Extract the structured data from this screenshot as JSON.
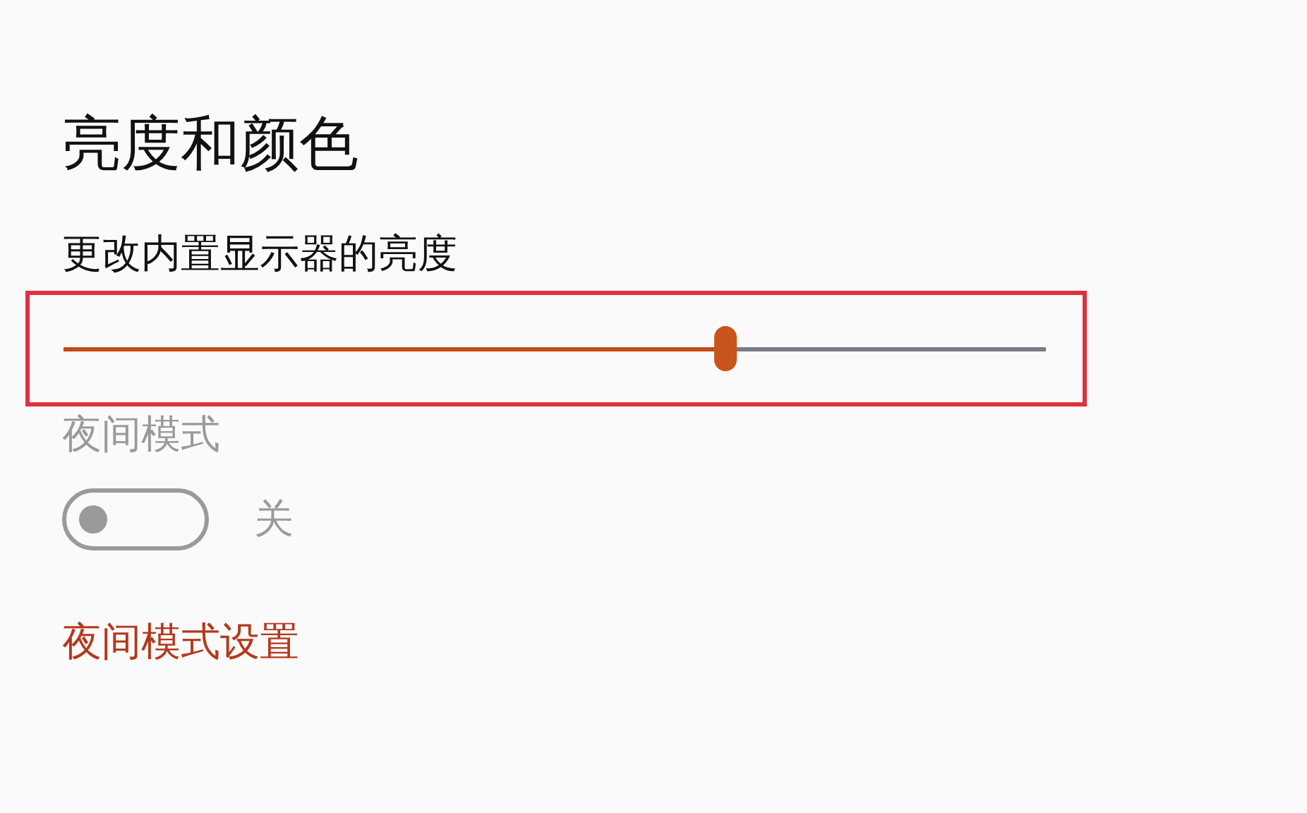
{
  "title": "亮度和颜色",
  "brightness": {
    "label": "更改内置显示器的亮度",
    "level": 0.685,
    "highlighted": true
  },
  "night_mode": {
    "label": "夜间模式",
    "disabled": true,
    "on": false,
    "state_text": "关"
  },
  "settings_link": "夜间模式设置"
}
